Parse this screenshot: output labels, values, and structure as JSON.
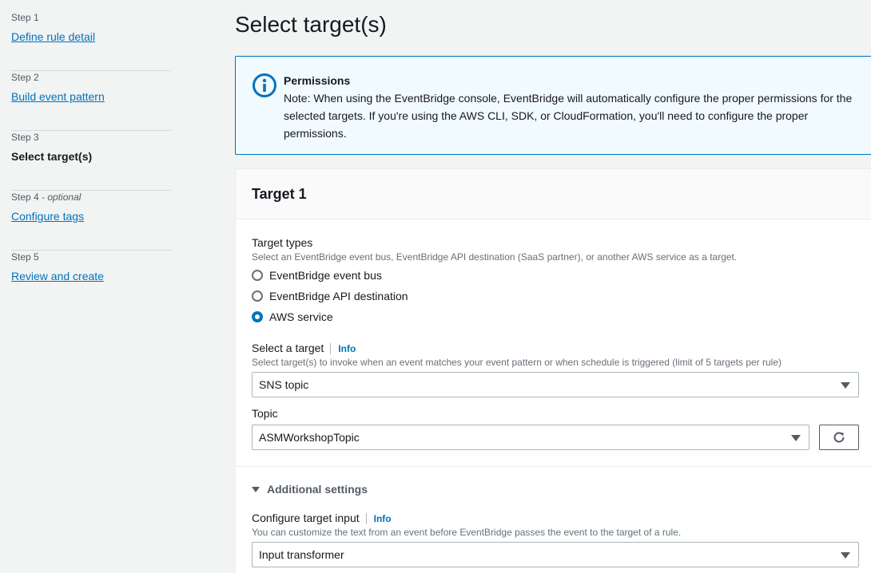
{
  "steps": [
    {
      "num": "Step 1",
      "label": "Define rule detail"
    },
    {
      "num": "Step 2",
      "label": "Build event pattern"
    },
    {
      "num": "Step 3",
      "label": "Select target(s)"
    },
    {
      "num": "Step 4",
      "optional": "optional",
      "label": "Configure tags"
    },
    {
      "num": "Step 5",
      "label": "Review and create"
    }
  ],
  "page_title": "Select target(s)",
  "alert": {
    "title": "Permissions",
    "text": "Note: When using the EventBridge console, EventBridge will automatically configure the proper permissions for the selected targets. If you're using the AWS CLI, SDK, or CloudFormation, you'll need to configure the proper permissions."
  },
  "target": {
    "title": "Target 1",
    "types_label": "Target types",
    "types_desc": "Select an EventBridge event bus, EventBridge API destination (SaaS partner), or another AWS service as a target.",
    "options": [
      "EventBridge event bus",
      "EventBridge API destination",
      "AWS service"
    ],
    "selected_option": "AWS service",
    "select_target_label": "Select a target",
    "info": "Info",
    "select_target_desc": "Select target(s) to invoke when an event matches your event pattern or when schedule is triggered (limit of 5 targets per rule)",
    "select_target_value": "SNS topic",
    "topic_label": "Topic",
    "topic_value": "ASMWorkshopTopic",
    "additional_settings": "Additional settings",
    "configure_input_label": "Configure target input",
    "configure_input_desc": "You can customize the text from an event before EventBridge passes the event to the target of a rule.",
    "configure_input_value": "Input transformer"
  },
  "colors": {
    "link": "#0073bb",
    "alert_bg": "#f1faff",
    "page_bg": "#f2f3f3"
  }
}
